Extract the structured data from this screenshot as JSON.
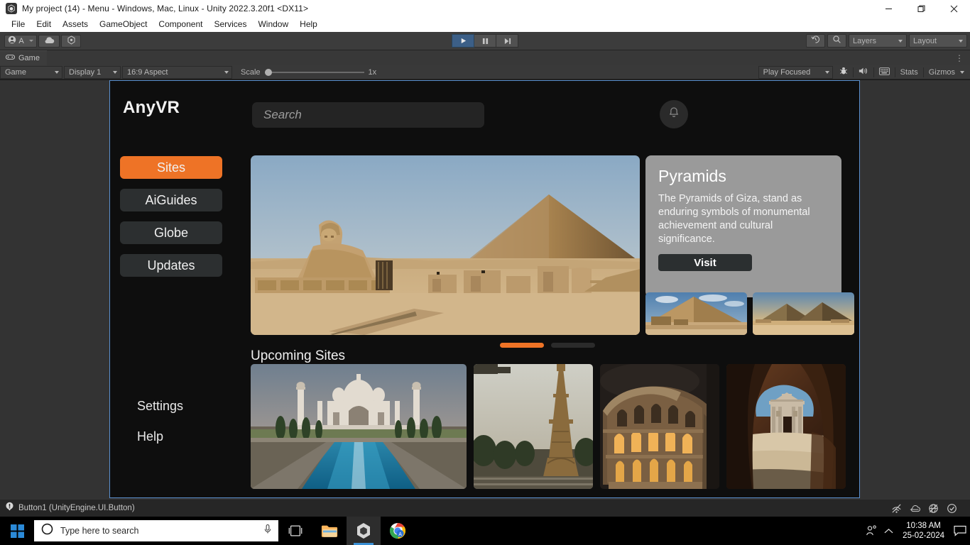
{
  "window": {
    "title": "My project (14) - Menu - Windows, Mac, Linux - Unity 2022.3.20f1 <DX11>",
    "app_icon": "unity-icon",
    "minimize": "minimize-icon",
    "maximize": "maximize-icon",
    "close": "close-icon"
  },
  "menubar": {
    "items": [
      {
        "label": "File"
      },
      {
        "label": "Edit"
      },
      {
        "label": "Assets"
      },
      {
        "label": "GameObject"
      },
      {
        "label": "Component"
      },
      {
        "label": "Services"
      },
      {
        "label": "Window"
      },
      {
        "label": "Help"
      }
    ]
  },
  "toolbar": {
    "account_label": "A",
    "account_icon": "account-icon",
    "cloud_icon": "cloud-icon",
    "services_icon": "unity-services-icon",
    "play_icon": "play-icon",
    "pause_icon": "pause-icon",
    "step_icon": "step-icon",
    "undo_history_icon": "undo-history-icon",
    "search_icon": "search-icon",
    "layers_label": "Layers",
    "layout_label": "Layout"
  },
  "game_tab": {
    "label": "Game",
    "tab_icon": "game-controller-icon",
    "kebab_icon": "kebab-menu-icon"
  },
  "game_bar": {
    "view_mode": "Game",
    "display": "Display 1",
    "aspect": "16:9 Aspect",
    "scale_label": "Scale",
    "scale_value": "1x",
    "play_mode": "Play Focused",
    "mute_icon": "mute-audio-icon",
    "frame_debugger_icon": "frame-debugger-icon",
    "grid_icon": "grid-icon",
    "stats_label": "Stats",
    "gizmos_label": "Gizmos"
  },
  "app": {
    "logo": "AnyVR",
    "search_placeholder": "Search",
    "bell_icon": "notification-bell-icon",
    "nav": [
      {
        "label": "Sites",
        "active": true
      },
      {
        "label": "AiGuides",
        "active": false
      },
      {
        "label": "Globe",
        "active": false
      },
      {
        "label": "Updates",
        "active": false
      }
    ],
    "links": [
      {
        "label": "Settings"
      },
      {
        "label": "Help"
      }
    ],
    "hero": {
      "alt": "great-sphinx-and-pyramid-of-giza"
    },
    "info_card": {
      "title": "Pyramids",
      "description": "The Pyramids of Giza, stand as enduring symbols of monumental achievement and cultural significance.",
      "button": "Visit"
    },
    "card_thumbs": [
      {
        "alt": "pyramid-of-menkaure"
      },
      {
        "alt": "pyramids-of-giza-desert"
      }
    ],
    "carousel": {
      "total": 2,
      "active_index": 0
    },
    "section_title": "Upcoming Sites",
    "upcoming": [
      {
        "alt": "taj-mahal"
      },
      {
        "alt": "eiffel-tower"
      },
      {
        "alt": "colosseum"
      },
      {
        "alt": "petra-treasury"
      }
    ]
  },
  "status_bar": {
    "icon": "info-icon",
    "message": "Button1 (UnityEngine.UI.Button)"
  },
  "taskbar": {
    "start_icon": "windows-start-icon",
    "search_icon": "cortana-circle-icon",
    "search_placeholder": "Type here to search",
    "mic_icon": "microphone-icon",
    "task_view_icon": "task-view-icon",
    "apps": [
      {
        "name": "file-explorer-icon"
      },
      {
        "name": "unity-icon"
      },
      {
        "name": "chrome-icon"
      }
    ],
    "tray": {
      "people_icon": "people-icon",
      "chevron_up_icon": "show-hidden-icons-icon",
      "time": "10:38 AM",
      "date": "25-02-2024",
      "notification_icon": "action-center-icon",
      "top_icons": [
        {
          "name": "network-muted-icon"
        },
        {
          "name": "onedrive-icon"
        },
        {
          "name": "no-internet-icon"
        },
        {
          "name": "security-check-icon"
        }
      ]
    }
  },
  "colors": {
    "accent_orange": "#ee7326",
    "unity_chrome": "#3c3c3c",
    "app_background": "#0e0e0e",
    "card_grey": "#9a9a9a",
    "selection_blue": "#5a8fce"
  }
}
